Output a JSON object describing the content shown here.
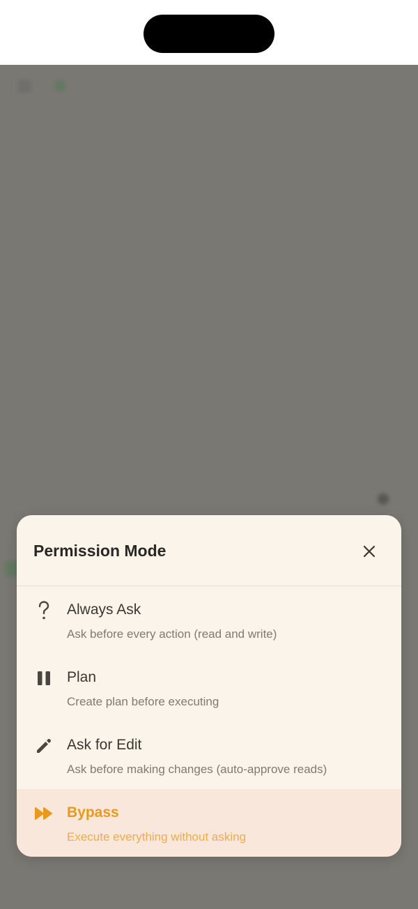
{
  "sheet": {
    "title": "Permission Mode",
    "close_icon": "close-icon"
  },
  "options": [
    {
      "label": "Always Ask",
      "description": "Ask before every action (read and write)",
      "icon": "question-icon",
      "selected": false
    },
    {
      "label": "Plan",
      "description": "Create plan before executing",
      "icon": "pause-icon",
      "selected": false
    },
    {
      "label": "Ask for Edit",
      "description": "Ask before making changes (auto-approve reads)",
      "icon": "pencil-icon",
      "selected": false
    },
    {
      "label": "Bypass",
      "description": "Execute everything without asking",
      "icon": "fast-forward-icon",
      "selected": true
    }
  ],
  "colors": {
    "sheet_bg": "#fbf4ea",
    "selected_bg": "#f8e7da",
    "accent": "#e89a1e",
    "overlay": "#7a7873"
  }
}
